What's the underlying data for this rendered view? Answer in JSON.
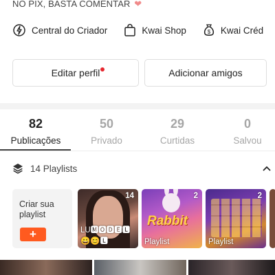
{
  "bio": {
    "line": "NO PIX, BASTA COMENTAR",
    "heart": "❤"
  },
  "links": [
    {
      "label": "Central do Criador",
      "icon": "lightning-circle-icon"
    },
    {
      "label": "Kwai Shop",
      "icon": "shopping-bag-icon"
    },
    {
      "label": "Kwai Créd",
      "icon": "money-bag-icon"
    }
  ],
  "actions": {
    "edit_label": "Editar perfil",
    "add_label": "Adicionar amigos"
  },
  "stats": [
    {
      "num": "82",
      "label": "Publicações"
    },
    {
      "num": "50",
      "label": "Privado"
    },
    {
      "num": "29",
      "label": "Curtidas"
    },
    {
      "num": "0",
      "label": "Salvou"
    }
  ],
  "playlists": {
    "header": "14 Playlists",
    "create_label": "Criar sua playlist",
    "plus": "+",
    "items": [
      {
        "count": "14",
        "caption": "LU🅼🅾🅳🅴🅻😀😊🅻"
      },
      {
        "count": "2",
        "caption": "Playlist",
        "art_text": "Rabbit"
      },
      {
        "count": "2",
        "caption": "Playlist"
      }
    ]
  },
  "colors": {
    "accent": "#ff5a1f",
    "notification": "#e6262e",
    "muted": "#a6a6a6"
  }
}
